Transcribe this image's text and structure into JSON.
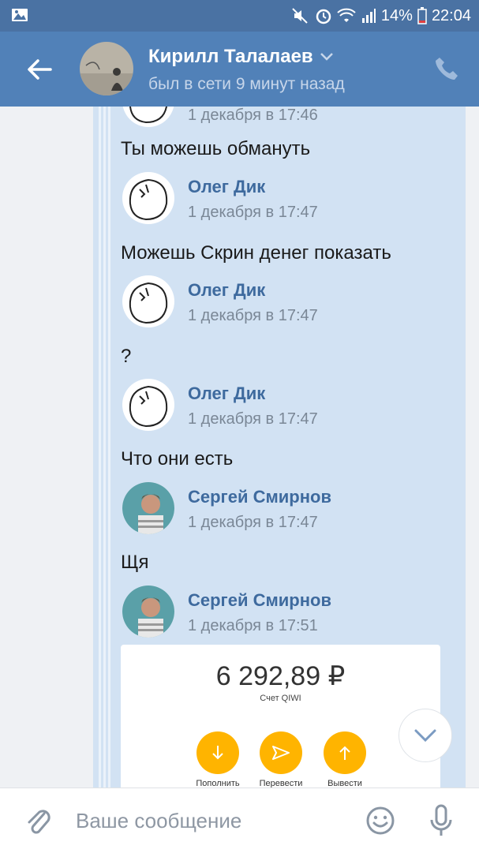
{
  "status_bar": {
    "battery": "14%",
    "time": "22:04"
  },
  "header": {
    "title": "Кирилл Талалаев",
    "subtitle": "был в сети 9 минут назад"
  },
  "chat": {
    "partial_time": "1 декабря в 17:46",
    "items": [
      {
        "text": "Ты можешь обмануть"
      },
      {
        "name": "Олег Дик",
        "time": "1 декабря в 17:47"
      },
      {
        "text": "Можешь Скрин денег показать"
      },
      {
        "name": "Олег Дик",
        "time": "1 декабря в 17:47"
      },
      {
        "text": "?"
      },
      {
        "name": "Олег Дик",
        "time": "1 декабря в 17:47"
      },
      {
        "text": "Что они есть"
      },
      {
        "name": "Сергей Смирнов",
        "time": "1 декабря в 17:47"
      },
      {
        "text": "Щя"
      },
      {
        "name": "Сергей Смирнов",
        "time": "1 декабря в 17:51"
      }
    ],
    "attachment": {
      "amount": "6 292,89 ₽",
      "account": "Счет QIWI",
      "actions": [
        "Пополнить",
        "Перевести",
        "Вывести"
      ]
    }
  },
  "composer": {
    "placeholder": "Ваше сообщение"
  },
  "colors": {
    "header": "#5181b8",
    "status_bar": "#4a72a3",
    "bubble": "#d2e2f3",
    "name": "#3e6a9e",
    "qiwi_accent": "#ffb400"
  }
}
